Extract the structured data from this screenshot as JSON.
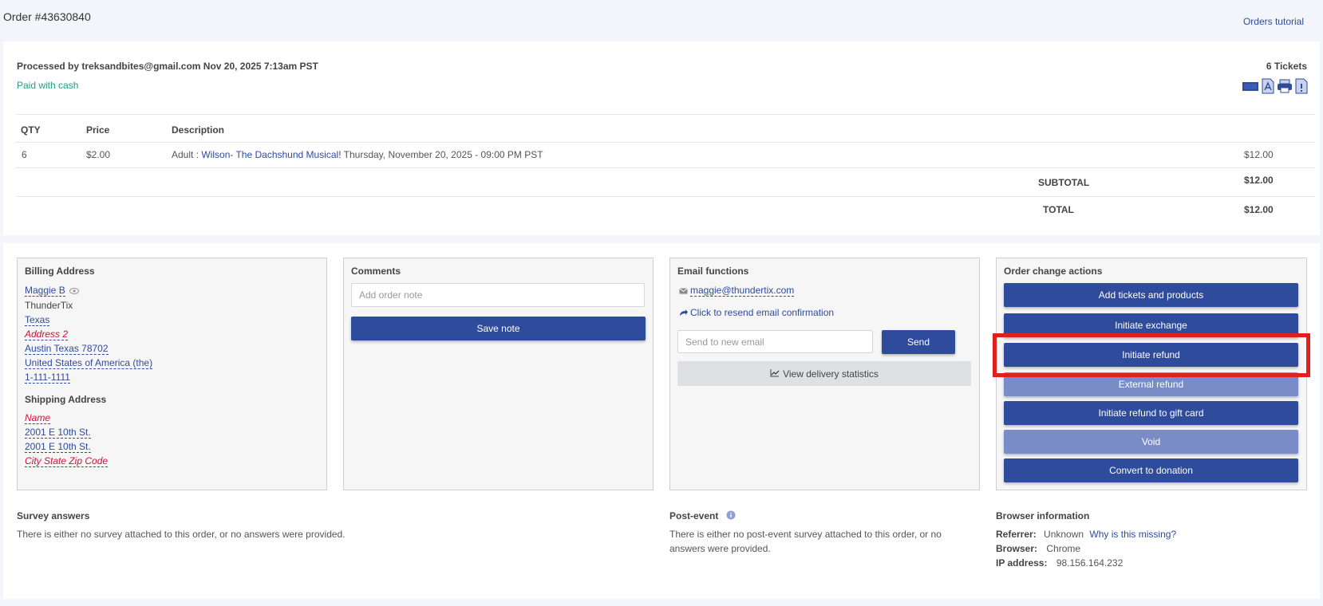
{
  "header": {
    "title": "Order #43630840",
    "tutorial_link": "Orders tutorial"
  },
  "summary": {
    "processed_by": "Processed by treksandbites@gmail.com Nov 20, 2025 7:13am PST",
    "payment": "Paid with cash",
    "tickets_count": "6 Tickets",
    "icons": [
      "ticket-icon",
      "pdf-icon",
      "print-icon",
      "document-alert-icon"
    ]
  },
  "items_table": {
    "headers": {
      "qty": "QTY",
      "price": "Price",
      "description": "Description"
    },
    "rows": [
      {
        "qty": "6",
        "price": "$2.00",
        "desc_prefix": "Adult : ",
        "event_link": "Wilson- The Dachshund Musical!",
        "desc_suffix": " Thursday, November 20, 2025 - 09:00 PM PST",
        "total": "$12.00"
      }
    ],
    "subtotal_label": "SUBTOTAL",
    "subtotal_value": "$12.00",
    "total_label": "TOTAL",
    "total_value": "$12.00"
  },
  "billing": {
    "title": "Billing Address",
    "name": "Maggie B",
    "company": "ThunderTix",
    "state": "Texas",
    "address2": "Address 2",
    "city_line": "Austin Texas 78702",
    "country": "United States of America (the)",
    "phone": "1-111-1111",
    "shipping_title": "Shipping Address",
    "ship_name": "Name",
    "ship_line1": "2001 E 10th St.",
    "ship_line2": "2001 E 10th St.",
    "ship_city": "City State Zip Code"
  },
  "comments": {
    "title": "Comments",
    "placeholder": "Add order note",
    "save_label": "Save note"
  },
  "email": {
    "title": "Email functions",
    "address": "maggie@thundertix.com",
    "resend_label": "Click to resend email confirmation",
    "new_email_placeholder": "Send to new email",
    "send_label": "Send",
    "stats_label": "View delivery statistics"
  },
  "actions": {
    "title": "Order change actions",
    "add": "Add tickets and products",
    "exchange": "Initiate exchange",
    "refund": "Initiate refund",
    "external_refund": "External refund",
    "gift_card_refund": "Initiate refund to gift card",
    "void": "Void",
    "donation": "Convert to donation"
  },
  "survey": {
    "title": "Survey answers",
    "text": "There is either no survey attached to this order, or no answers were provided."
  },
  "post_event": {
    "title": "Post-event",
    "text_line1": "There is either no post-event survey attached to this order, or no",
    "text_line2": "answers were provided."
  },
  "browser_info": {
    "title": "Browser information",
    "referrer_label": "Referrer:",
    "referrer_value": "Unknown",
    "referrer_link": "Why is this missing?",
    "browser_label": "Browser:",
    "browser_value": "Chrome",
    "ip_label": "IP address:",
    "ip_value": "98.156.164.232"
  },
  "colors": {
    "primary_button": "#2f4b9c",
    "disabled_button": "#7a8cc8",
    "paid_green": "#1fa07e",
    "highlight_red": "#e01f1f",
    "missing_field_red": "#d0103a"
  }
}
